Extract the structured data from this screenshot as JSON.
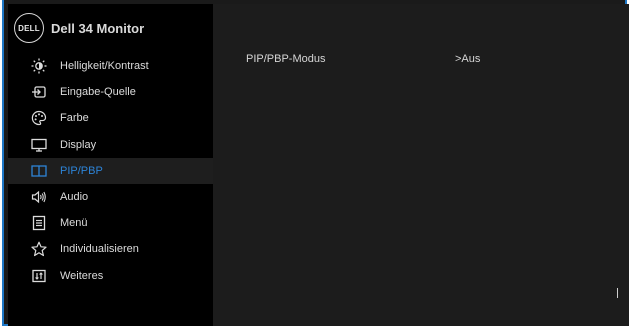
{
  "header": {
    "logo_text": "DELL",
    "title": "Dell 34 Monitor"
  },
  "menu": {
    "items": [
      {
        "label": "Helligkeit/Kontrast",
        "icon": "brightness-icon",
        "active": false
      },
      {
        "label": "Eingabe-Quelle",
        "icon": "input-source-icon",
        "active": false
      },
      {
        "label": "Farbe",
        "icon": "color-palette-icon",
        "active": false
      },
      {
        "label": "Display",
        "icon": "display-icon",
        "active": false
      },
      {
        "label": "PIP/PBP",
        "icon": "pip-pbp-icon",
        "active": true
      },
      {
        "label": "Audio",
        "icon": "speaker-icon",
        "active": false
      },
      {
        "label": "Menü",
        "icon": "menu-icon",
        "active": false
      },
      {
        "label": "Individualisieren",
        "icon": "star-icon",
        "active": false
      },
      {
        "label": "Weiteres",
        "icon": "others-icon",
        "active": false
      }
    ]
  },
  "main": {
    "setting": {
      "label": "PIP/PBP-Modus",
      "value": ">Aus"
    }
  },
  "colors": {
    "accent": "#2d84d8",
    "frame": "#1e78c8"
  }
}
